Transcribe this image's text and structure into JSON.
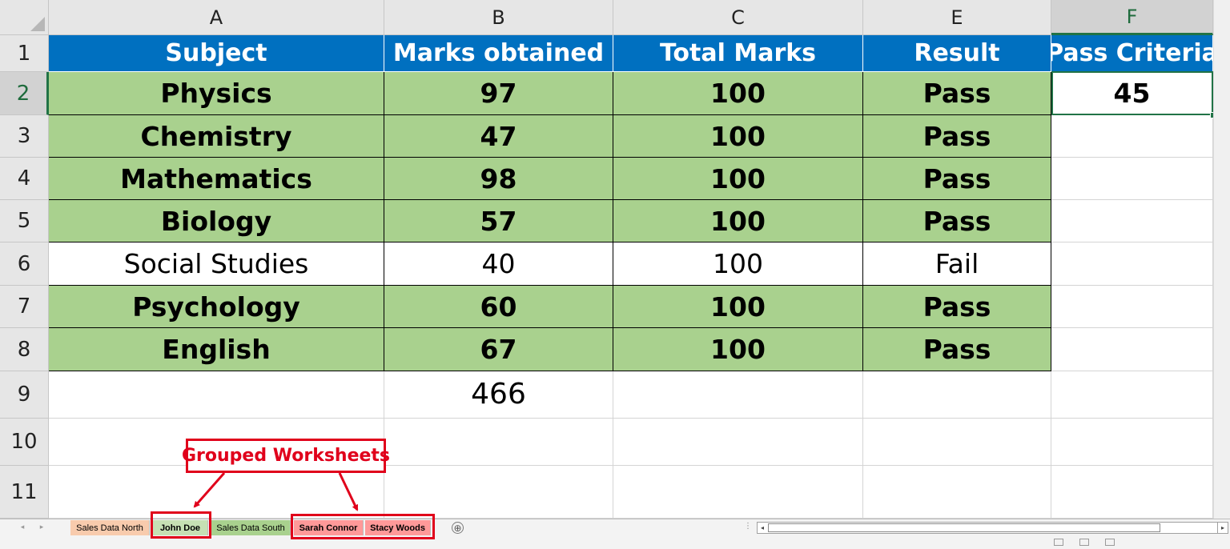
{
  "sheet": {
    "columns": [
      "A",
      "B",
      "C",
      "E",
      "F"
    ],
    "selected_column": "F",
    "rows": [
      "1",
      "2",
      "3",
      "4",
      "5",
      "6",
      "7",
      "8",
      "9",
      "10",
      "11"
    ],
    "selected_row": "2",
    "header": [
      "Subject",
      "Marks obtained",
      "Total Marks",
      "Result",
      "Pass Criteria"
    ],
    "data": [
      [
        "Physics",
        "97",
        "100",
        "Pass"
      ],
      [
        "Chemistry",
        "47",
        "100",
        "Pass"
      ],
      [
        "Mathematics",
        "98",
        "100",
        "Pass"
      ],
      [
        "Biology",
        "57",
        "100",
        "Pass"
      ],
      [
        "Social Studies",
        "40",
        "100",
        "Fail"
      ],
      [
        "Psychology",
        "60",
        "100",
        "Pass"
      ],
      [
        "English",
        "67",
        "100",
        "Pass"
      ]
    ],
    "pass_criteria": "45",
    "total_marks_sum": "466",
    "active_cell": "F2"
  },
  "tabs": [
    {
      "label": "Sales Data North",
      "color": "#f8cbad",
      "bold": false
    },
    {
      "label": "John Doe",
      "color": "#c6e0b4",
      "bold": true
    },
    {
      "label": "Sales Data South",
      "color": "#a9d18e",
      "bold": false
    },
    {
      "label": "Sarah Connor",
      "color": "#ff9999",
      "bold": true
    },
    {
      "label": "Stacy Woods",
      "color": "#ff9999",
      "bold": true
    }
  ],
  "add_sheet_symbol": "⊕",
  "annotation": {
    "label": "Grouped Worksheets",
    "color": "#e0001b"
  },
  "colors": {
    "header_fill": "#0070c0",
    "pass_fill": "#a9d18e",
    "excel_green": "#217346"
  }
}
